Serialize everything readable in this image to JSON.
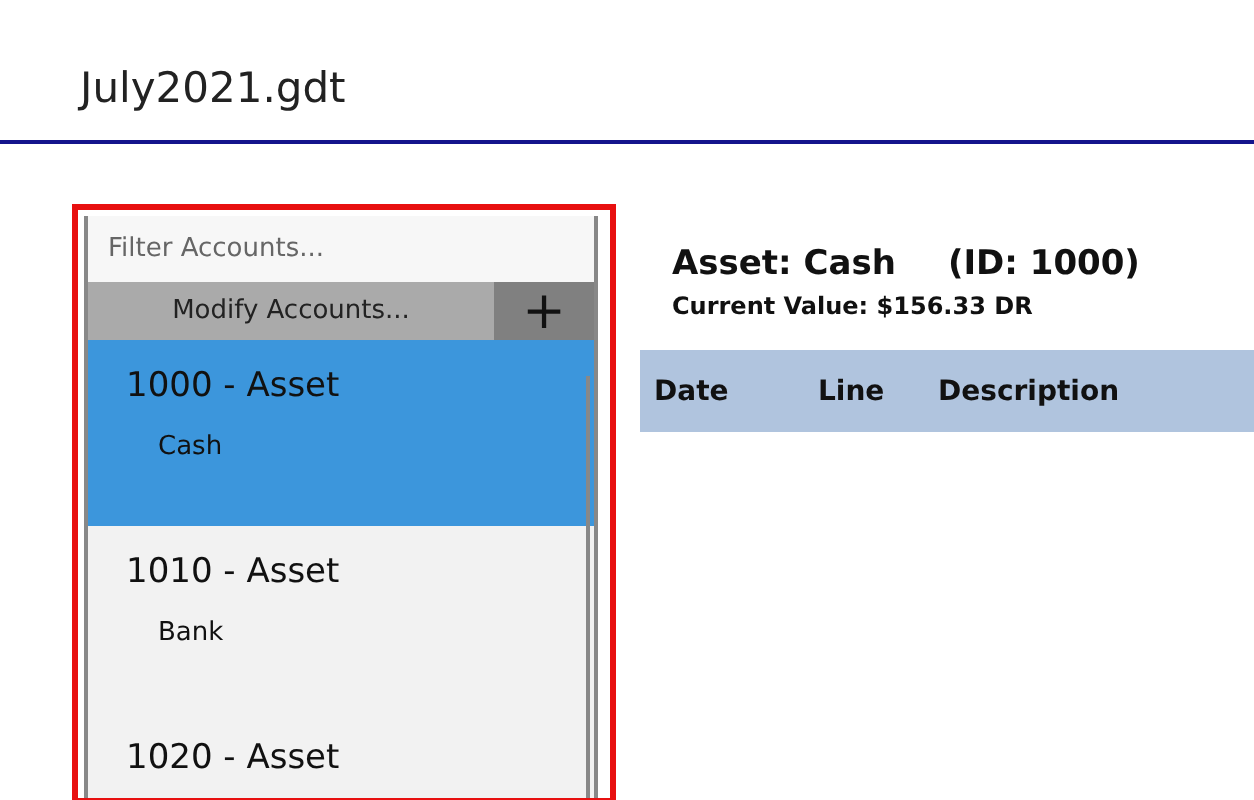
{
  "window": {
    "title": "July2021.gdt"
  },
  "accounts_panel": {
    "filter": {
      "placeholder": "Filter Accounts..."
    },
    "modify_button": "Modify Accounts...",
    "add_button": "+",
    "items": [
      {
        "code": "1000 - Asset",
        "name": "Cash",
        "selected": true
      },
      {
        "code": "1010 - Asset",
        "name": "Bank",
        "selected": false
      },
      {
        "code": "1020 - Asset",
        "selected": false
      }
    ]
  },
  "detail": {
    "heading": "Asset: Cash",
    "id": "(ID: 1000)",
    "current_value": "Current Value: $156.33 DR",
    "table": {
      "columns": [
        "Date",
        "Line",
        "Description"
      ]
    }
  }
}
